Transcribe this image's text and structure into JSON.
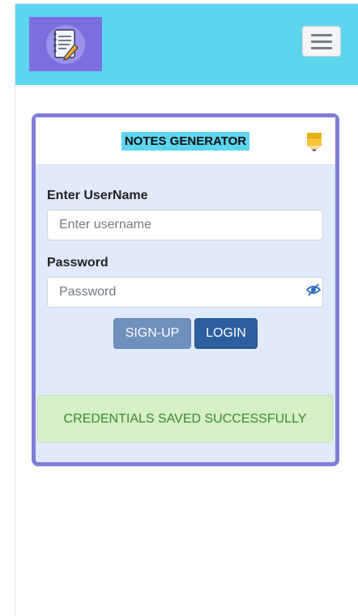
{
  "navbar": {
    "logo_icon": "notebook-pen-icon",
    "toggle_icon": "hamburger-icon",
    "bg_color": "#5dd5ee"
  },
  "card": {
    "title": "NOTES GENERATOR",
    "header_icon": "pencil-icon",
    "border_color": "#7f7ed6"
  },
  "form": {
    "username_label": "Enter UserName",
    "username_placeholder": "Enter username",
    "username_value": "",
    "password_label": "Password",
    "password_placeholder": "Password",
    "password_value": "",
    "password_toggle_icon": "eye-slash-icon",
    "signup_label": "SIGN-UP",
    "login_label": "LOGIN"
  },
  "alert": {
    "message": "CREDENTIALS SAVED SUCCESSFULLY",
    "color": "#3c8a2e"
  }
}
